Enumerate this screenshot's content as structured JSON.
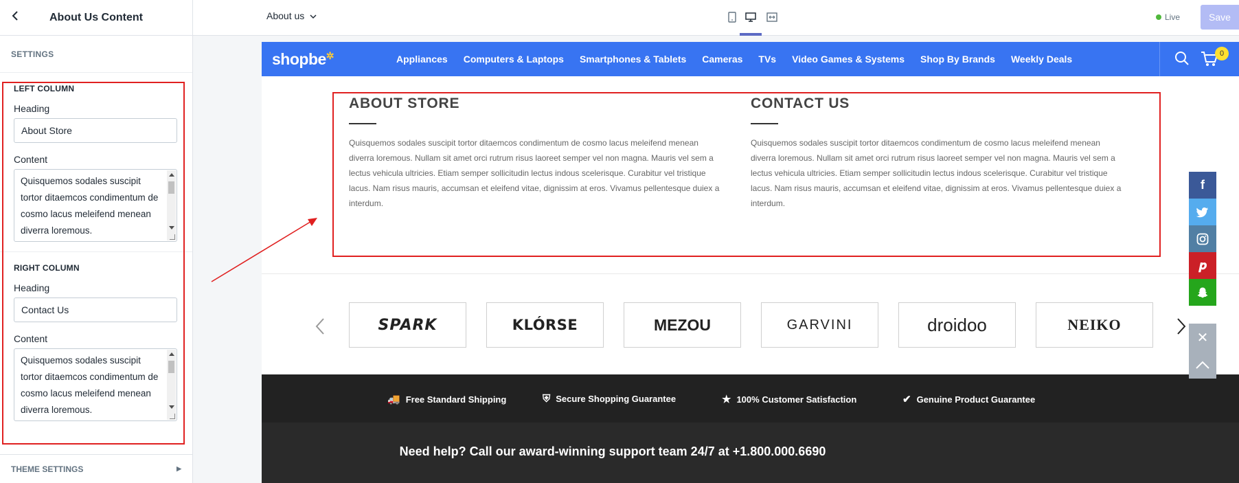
{
  "sidebar": {
    "back_icon": "chevron-left-icon",
    "title": "About Us Content",
    "section_label": "SETTINGS",
    "left_column": {
      "title": "LEFT COLUMN",
      "heading_label": "Heading",
      "heading_value": "About Store",
      "content_label": "Content",
      "content_value": "Quisquemos sodales suscipit tortor ditaemcos condimentum de cosmo lacus meleifend menean diverra loremous."
    },
    "right_column": {
      "title": "RIGHT COLUMN",
      "heading_label": "Heading",
      "heading_value": "Contact Us",
      "content_label": "Content",
      "content_value": "Quisquemos sodales suscipit tortor ditaemcos condimentum de cosmo lacus meleifend menean diverra loremous."
    },
    "footer_label": "THEME SETTINGS"
  },
  "topbar": {
    "page_select": "About us",
    "views": [
      "mobile-view-icon",
      "desktop-view-icon",
      "fullwidth-view-icon"
    ],
    "active_view": "desktop",
    "live_label": "Live",
    "save_label": "Save"
  },
  "store": {
    "logo": "shopbe",
    "nav": [
      "Appliances",
      "Computers & Laptops",
      "Smartphones & Tablets",
      "Cameras",
      "TVs",
      "Video Games & Systems",
      "Shop By Brands",
      "Weekly Deals"
    ],
    "cart_count": "0",
    "about": {
      "left_heading": "ABOUT STORE",
      "left_text": "Quisquemos sodales suscipit tortor ditaemcos condimentum de cosmo lacus meleifend menean diverra loremous. Nullam sit amet orci rutrum risus laoreet semper vel non magna. Mauris vel sem a lectus vehicula ultricies. Etiam semper sollicitudin lectus indous scelerisque. Curabitur vel tristique lacus. Nam risus mauris, accumsan et eleifend vitae, dignissim at eros. Vivamus pellentesque duiex a interdum.",
      "right_heading": "CONTACT US",
      "right_text": "Quisquemos sodales suscipit tortor ditaemcos condimentum de cosmo lacus meleifend menean diverra loremous. Nullam sit amet orci rutrum risus laoreet semper vel non magna. Mauris vel sem a lectus vehicula ultricies. Etiam semper sollicitudin lectus indous scelerisque. Curabitur vel tristique lacus. Nam risus mauris, accumsan et eleifend vitae, dignissim at eros. Vivamus pellentesque duiex a interdum."
    },
    "brands": [
      "SPARK",
      "KLÓRSE",
      "MEZOU",
      "GARVINI",
      "droidoo",
      "NEIKO"
    ],
    "features": [
      "Free Standard Shipping",
      "Secure Shopping Guarantee",
      "100% Customer Satisfaction",
      "Genuine Product Guarantee"
    ],
    "help": "Need help? Call our award-winning support team 24/7 at +1.800.000.6690",
    "social": [
      {
        "name": "facebook-icon",
        "glyph": "f",
        "color": "#3b5998"
      },
      {
        "name": "twitter-icon",
        "glyph": "🐦",
        "color": "#55acee"
      },
      {
        "name": "instagram-icon",
        "glyph": "◎",
        "color": "#517fa4"
      },
      {
        "name": "pinterest-icon",
        "glyph": "P",
        "color": "#cb2027"
      },
      {
        "name": "snapchat-icon",
        "glyph": "👻",
        "color": "#25a61c"
      }
    ]
  },
  "colors": {
    "accent": "#5c6ac4",
    "store_nav": "#3874f2",
    "annotation": "#e02020"
  }
}
